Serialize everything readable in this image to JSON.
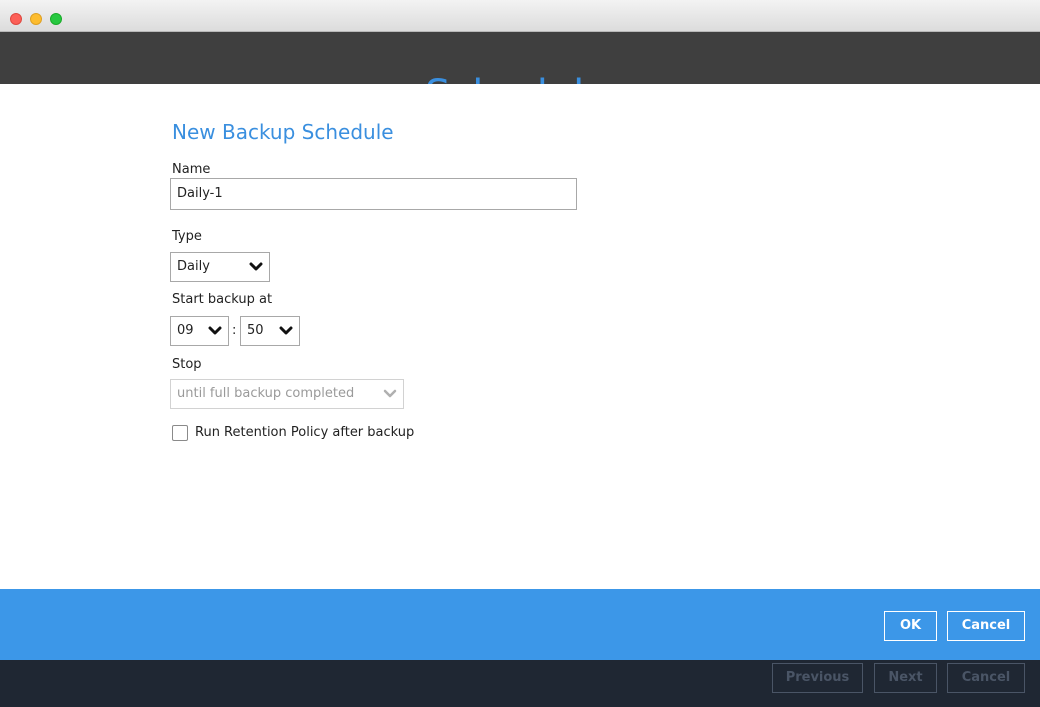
{
  "window": {
    "background_title": "Schedule"
  },
  "dialog": {
    "title": "New Backup Schedule",
    "name": {
      "label": "Name",
      "value": "Daily-1"
    },
    "type": {
      "label": "Type",
      "value": "Daily"
    },
    "start": {
      "label": "Start backup at",
      "hour": "09",
      "separator": ":",
      "minute": "50"
    },
    "stop": {
      "label": "Stop",
      "value": "until full backup completed"
    },
    "retention": {
      "label": "Run Retention Policy after backup",
      "checked": false
    }
  },
  "actions": {
    "ok_label": "OK",
    "cancel_label": "Cancel"
  },
  "nav": {
    "previous_label": "Previous",
    "next_label": "Next",
    "cancel_label": "Cancel"
  },
  "colors": {
    "accent": "#3a8fdf",
    "action_bar": "#3c97e8",
    "nav_bar": "#1f2733"
  }
}
